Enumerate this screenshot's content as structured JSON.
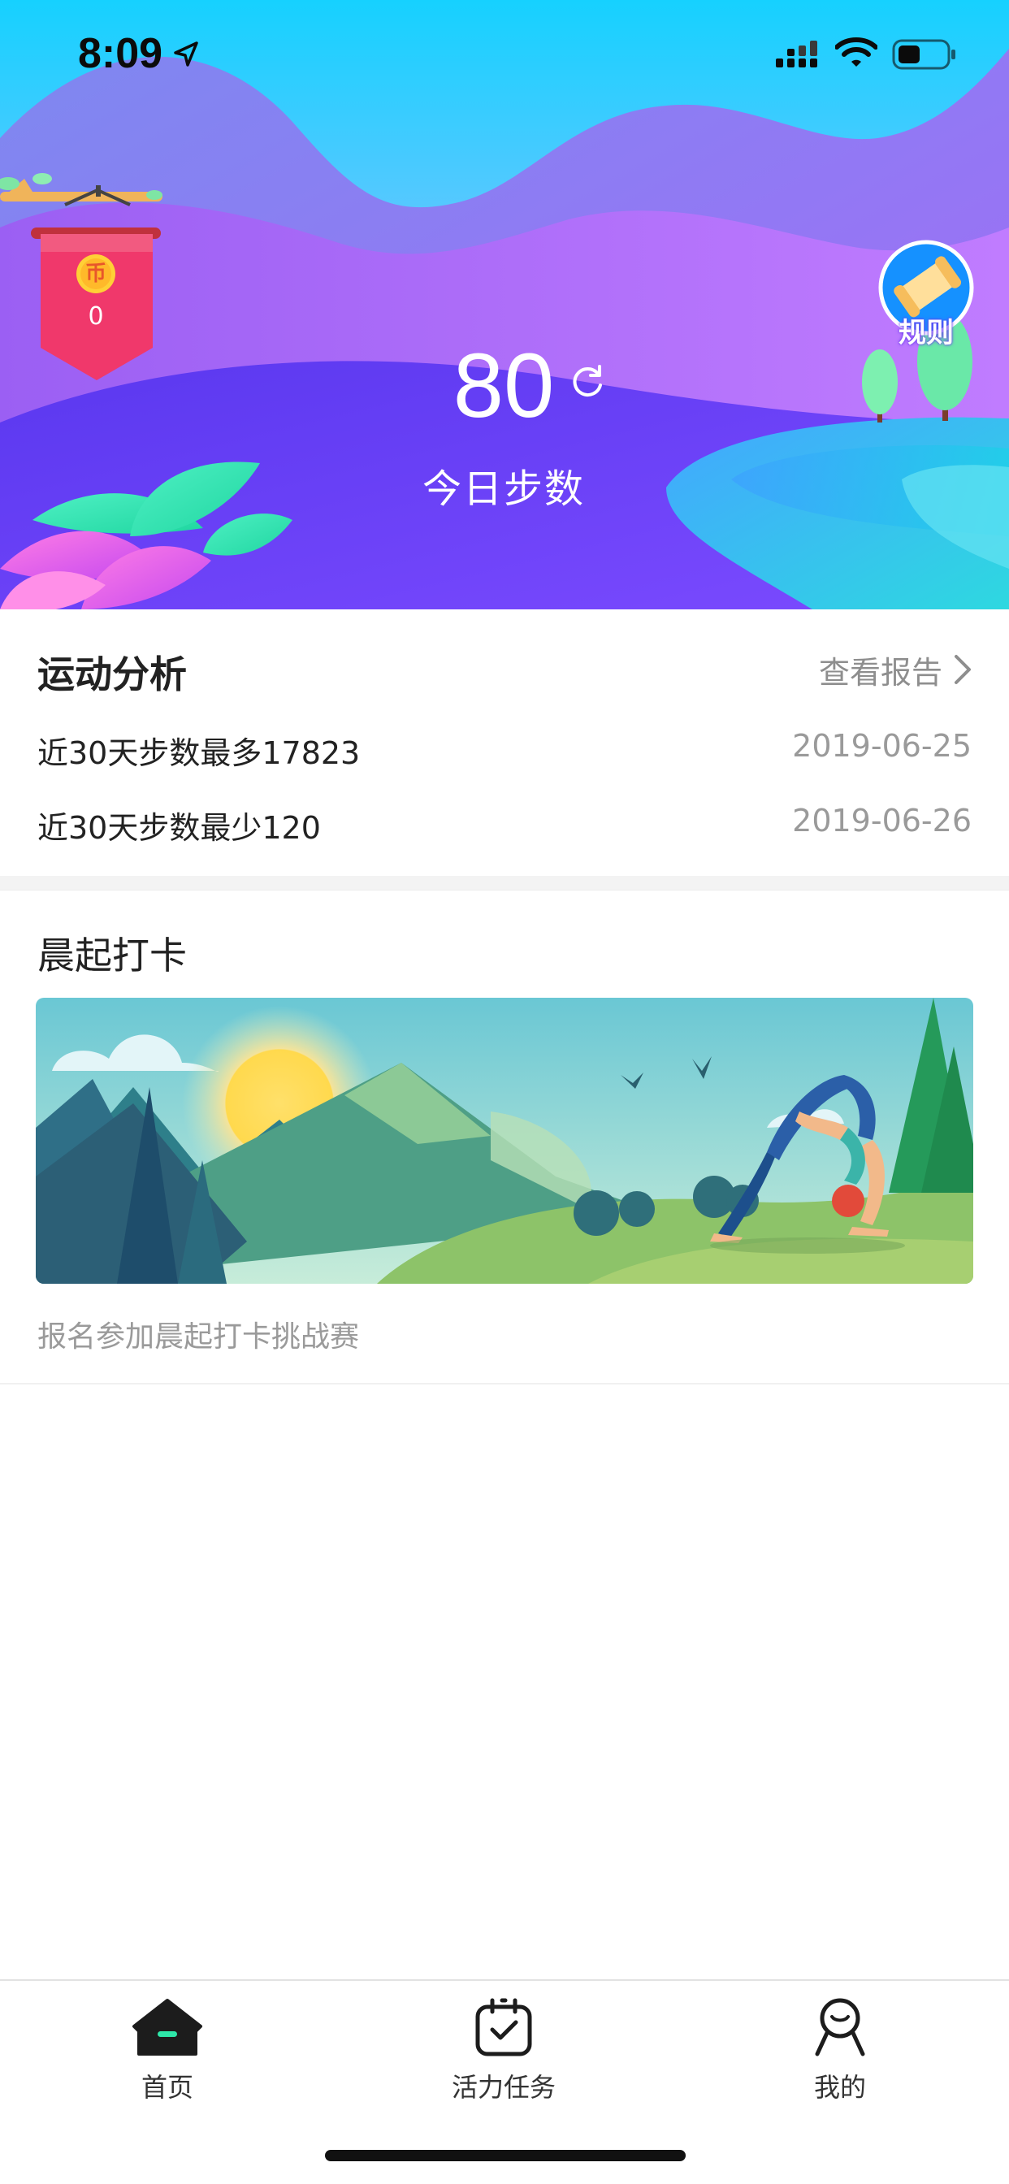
{
  "status_bar": {
    "time": "8:09"
  },
  "hero": {
    "coin_symbol": "币",
    "coin_count": "0",
    "rules_label": "规则",
    "steps_today": "80",
    "steps_label": "今日步数"
  },
  "analysis": {
    "title": "运动分析",
    "view_report": "查看报告",
    "rows": [
      {
        "text": "近30天步数最多17823",
        "date": "2019-06-25"
      },
      {
        "text": "近30天步数最少120",
        "date": "2019-06-26"
      }
    ]
  },
  "checkin": {
    "title": "晨起打卡",
    "subtitle": "报名参加晨起打卡挑战赛"
  },
  "tabbar": {
    "items": [
      {
        "label": "首页",
        "icon": "home-icon",
        "active": true
      },
      {
        "label": "活力任务",
        "icon": "calendar-check-icon",
        "active": false
      },
      {
        "label": "我的",
        "icon": "profile-icon",
        "active": false
      }
    ]
  },
  "colors": {
    "accent": "#2ee6a8",
    "hero_top": "#1fd2ff",
    "hero_purple": "#8a5cf6",
    "coin_banner": "#f0386b"
  }
}
